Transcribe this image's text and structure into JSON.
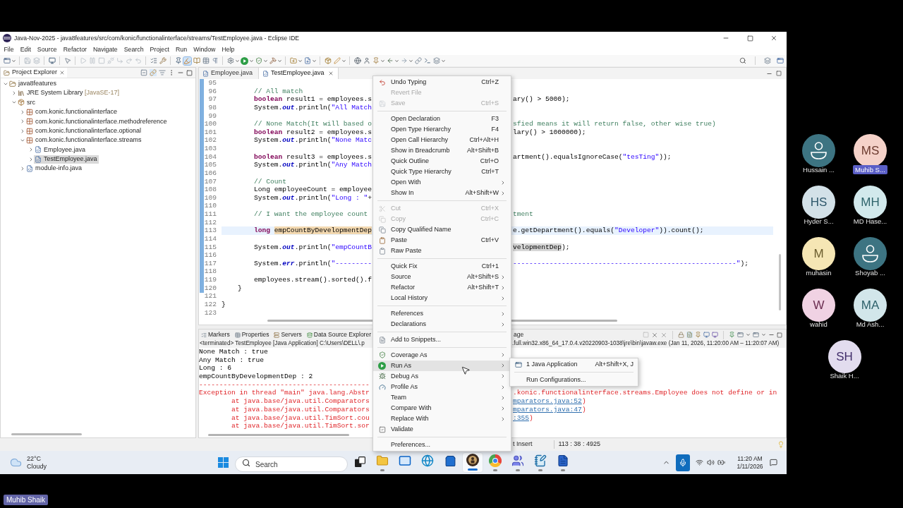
{
  "window": {
    "title": "Java-Nov-2025 - java8features/src/com/konic/functionalinterface/streams/TestEmployee.java - Eclipse IDE"
  },
  "menu_bar": [
    "File",
    "Edit",
    "Source",
    "Refactor",
    "Navigate",
    "Search",
    "Project",
    "Run",
    "Window",
    "Help"
  ],
  "toolbar": {
    "toggles": [
      {
        "on": true
      }
    ]
  },
  "project_explorer": {
    "title": "Project Explorer",
    "tree": [
      {
        "label": "java8features",
        "kind": "project",
        "expanded": true,
        "selected": false,
        "children": [
          {
            "label": "JRE System Library",
            "suffix": "[JavaSE-17]",
            "kind": "library",
            "expanded": false,
            "selected": false
          },
          {
            "label": "src",
            "kind": "source_folder",
            "expanded": true,
            "selected": false,
            "children": [
              {
                "label": "com.konic.functionalinterface",
                "kind": "package",
                "expanded": false,
                "selected": false
              },
              {
                "label": "com.konic.functionalinterface.methodreference",
                "kind": "package",
                "expanded": false,
                "selected": false
              },
              {
                "label": "com.konic.functionalinterface.optional",
                "kind": "package",
                "expanded": false,
                "selected": false
              },
              {
                "label": "com.konic.functionalinterface.streams",
                "kind": "package",
                "expanded": true,
                "selected": false,
                "children": [
                  {
                    "label": "Employee.java",
                    "kind": "java_file",
                    "expanded": false,
                    "selected": false
                  },
                  {
                    "label": "TestEmployee.java",
                    "kind": "java_file",
                    "expanded": false,
                    "selected": true
                  }
                ]
              },
              {
                "label": "module-info.java",
                "kind": "java_file",
                "expanded": false,
                "selected": false
              }
            ]
          }
        ]
      }
    ]
  },
  "editor": {
    "tabs": [
      {
        "label": "Employee.java",
        "selected": false
      },
      {
        "label": "TestEmployee.java",
        "selected": true
      }
    ],
    "lines": [
      {
        "number": "95",
        "current": false
      },
      {
        "number": "96",
        "current": false,
        "left": [
          {
            "kind": "comment",
            "text": "        // All match"
          }
        ]
      },
      {
        "number": "97",
        "current": false,
        "left": [
          {
            "kind": "keyword",
            "text": "        boolean"
          },
          {
            "kind": "plain",
            "text": " result1 = employees.s"
          }
        ],
        "right": [
          {
            "kind": "plain",
            "text": "ary() > 5000);"
          }
        ]
      },
      {
        "number": "98",
        "current": false,
        "left": [
          {
            "kind": "plain",
            "text": "        System."
          },
          {
            "kind": "field",
            "text": "out"
          },
          {
            "kind": "plain",
            "text": ".println("
          },
          {
            "kind": "string",
            "text": "\"All Match"
          }
        ]
      },
      {
        "number": "99",
        "current": false
      },
      {
        "number": "100",
        "current": false,
        "left": [
          {
            "kind": "comment",
            "text": "        // None Match(It will based o"
          }
        ],
        "right": [
          {
            "kind": "comment",
            "text": "sfied means it will return false, other wise true)"
          }
        ]
      },
      {
        "number": "101",
        "current": false,
        "left": [
          {
            "kind": "keyword",
            "text": "        boolean"
          },
          {
            "kind": "plain",
            "text": " result2 = employees.s"
          }
        ],
        "right": [
          {
            "kind": "plain",
            "text": "lary() > 1000000);"
          }
        ]
      },
      {
        "number": "102",
        "current": false,
        "left": [
          {
            "kind": "plain",
            "text": "        System."
          },
          {
            "kind": "field",
            "text": "out"
          },
          {
            "kind": "plain",
            "text": ".println("
          },
          {
            "kind": "string",
            "text": "\"None Matc"
          }
        ]
      },
      {
        "number": "103",
        "current": false
      },
      {
        "number": "104",
        "current": false,
        "left": [
          {
            "kind": "keyword",
            "text": "        boolean"
          },
          {
            "kind": "plain",
            "text": " result3 = employees.s"
          }
        ],
        "right": [
          {
            "kind": "plain",
            "text": "artment().equalsIgnoreCase("
          },
          {
            "kind": "string",
            "text": "\"tesTing\""
          },
          {
            "kind": "plain",
            "text": "));"
          }
        ]
      },
      {
        "number": "105",
        "current": false,
        "left": [
          {
            "kind": "plain",
            "text": "        System."
          },
          {
            "kind": "field",
            "text": "out"
          },
          {
            "kind": "plain",
            "text": ".println("
          },
          {
            "kind": "string",
            "text": "\"Any Match"
          }
        ]
      },
      {
        "number": "106",
        "current": false
      },
      {
        "number": "107",
        "current": false,
        "left": [
          {
            "kind": "comment",
            "text": "        // Count"
          }
        ]
      },
      {
        "number": "108",
        "current": false,
        "left": [
          {
            "kind": "plain",
            "text": "        Long employeeCount = employee"
          }
        ]
      },
      {
        "number": "109",
        "current": false,
        "left": [
          {
            "kind": "plain",
            "text": "        System."
          },
          {
            "kind": "field",
            "text": "out"
          },
          {
            "kind": "plain",
            "text": ".println("
          },
          {
            "kind": "string",
            "text": "\"Long : \""
          },
          {
            "kind": "plain",
            "text": "+"
          }
        ]
      },
      {
        "number": "110",
        "current": false
      },
      {
        "number": "111",
        "current": false,
        "left": [
          {
            "kind": "comment",
            "text": "        // I want the employee count"
          }
        ],
        "right": [
          {
            "kind": "comment",
            "text": "tment"
          }
        ]
      },
      {
        "number": "112",
        "current": false
      },
      {
        "number": "113",
        "current": true,
        "left": [
          {
            "kind": "keyword",
            "text": "        long "
          },
          {
            "kind": "mark_write",
            "text": "empCountByDevelopmentDep"
          }
        ],
        "right": [
          {
            "kind": "plain",
            "text": "e.getDepartment().equals("
          },
          {
            "kind": "string",
            "text": "\"Developer\""
          },
          {
            "kind": "plain",
            "text": ")).count();"
          }
        ]
      },
      {
        "number": "114",
        "current": false
      },
      {
        "number": "115",
        "current": false,
        "left": [
          {
            "kind": "plain",
            "text": "        System."
          },
          {
            "kind": "field",
            "text": "out"
          },
          {
            "kind": "plain",
            "text": ".println("
          },
          {
            "kind": "string",
            "text": "\"empCountB"
          }
        ],
        "right": [
          {
            "kind": "mark_read",
            "text": "velopmentDep"
          },
          {
            "kind": "plain",
            "text": ");"
          }
        ]
      },
      {
        "number": "116",
        "current": false
      },
      {
        "number": "117",
        "current": false,
        "left": [
          {
            "kind": "plain",
            "text": "        System."
          },
          {
            "kind": "field",
            "text": "err"
          },
          {
            "kind": "plain",
            "text": ".println("
          },
          {
            "kind": "string",
            "text": "\"---------"
          }
        ],
        "right": [
          {
            "kind": "string",
            "text": "-------------------------------------------------------\""
          },
          {
            "kind": "plain",
            "text": ");"
          }
        ]
      },
      {
        "number": "118",
        "current": false
      },
      {
        "number": "119",
        "current": false,
        "left": [
          {
            "kind": "plain",
            "text": "        employees.stream().sorted().f"
          }
        ]
      },
      {
        "number": "120",
        "current": false,
        "left": [
          {
            "kind": "plain",
            "text": "    }"
          }
        ]
      },
      {
        "number": "121",
        "current": false
      },
      {
        "number": "122",
        "current": false,
        "left": [
          {
            "kind": "plain",
            "text": "}"
          }
        ]
      },
      {
        "number": "123",
        "current": false
      }
    ]
  },
  "console": {
    "tabs": [
      {
        "label": "Markers",
        "selected": false
      },
      {
        "label": "Properties",
        "selected": false
      },
      {
        "label": "Servers",
        "selected": false
      },
      {
        "label": "Data Source Explorer",
        "selected": false
      },
      {
        "label": "age",
        "selected": false
      }
    ],
    "process_left": "<terminated> TestEmployee [Java Application] C:\\Users\\DELL\\.p",
    "process_right": ".full.win32.x86_64_17.0.4.v20220903-1038\\jre\\bin\\javaw.exe  (Jan 11, 2026, 11:20:00 AM – 11:20:07 AM)",
    "lines": [
      {
        "left": [
          {
            "kind": "out",
            "text": "None Match : true"
          }
        ]
      },
      {
        "left": [
          {
            "kind": "out",
            "text": "Any Match : true"
          }
        ]
      },
      {
        "left": [
          {
            "kind": "out",
            "text": "Long : 6"
          }
        ]
      },
      {
        "left": [
          {
            "kind": "out",
            "text": "empCountByDevelopmentDep : 2"
          }
        ]
      },
      {
        "left": [
          {
            "kind": "err",
            "text": "------------------------------------------"
          }
        ]
      },
      {
        "left": [
          {
            "kind": "err",
            "text": "Exception in thread \"main\" java.lang.Abstr"
          }
        ],
        "right": [
          {
            "kind": "err",
            "text": ".konic.functionalinterface.streams.Employee does not define or in"
          }
        ]
      },
      {
        "left": [
          {
            "kind": "err",
            "text": "        at java.base/java.util.Comparators"
          }
        ],
        "right": [
          {
            "kind": "link",
            "text": "mparators.java:52"
          },
          {
            "kind": "err",
            "text": ")"
          }
        ]
      },
      {
        "left": [
          {
            "kind": "err",
            "text": "        at java.base/java.util.Comparators"
          }
        ],
        "right": [
          {
            "kind": "link",
            "text": "mparators.java:47"
          },
          {
            "kind": "err",
            "text": ")"
          }
        ]
      },
      {
        "left": [
          {
            "kind": "err",
            "text": "        at java.base/java.util.TimSort.cou"
          }
        ],
        "right": [
          {
            "kind": "link",
            "text": ":355"
          },
          {
            "kind": "err",
            "text": ")"
          }
        ]
      },
      {
        "left": [
          {
            "kind": "err",
            "text": "        at java.base/java.util.TimSort.sor"
          }
        ]
      }
    ]
  },
  "status_bar": {
    "insert_mode": "t Insert",
    "cursor_position": "113 : 38 : 4925"
  },
  "context_menu": {
    "groups": [
      [
        {
          "label": "Undo Typing",
          "shortcut": "Ctrl+Z",
          "disabled": false,
          "has_submenu": false,
          "selected": false
        },
        {
          "label": "Revert File",
          "disabled": true,
          "has_submenu": false,
          "selected": false
        },
        {
          "label": "Save",
          "shortcut": "Ctrl+S",
          "disabled": true,
          "has_submenu": false,
          "selected": false
        }
      ],
      [
        {
          "label": "Open Declaration",
          "shortcut": "F3",
          "disabled": false,
          "has_submenu": false,
          "selected": false
        },
        {
          "label": "Open Type Hierarchy",
          "shortcut": "F4",
          "disabled": false,
          "has_submenu": false,
          "selected": false
        },
        {
          "label": "Open Call Hierarchy",
          "shortcut": "Ctrl+Alt+H",
          "disabled": false,
          "has_submenu": false,
          "selected": false
        },
        {
          "label": "Show in Breadcrumb",
          "shortcut": "Alt+Shift+B",
          "disabled": false,
          "has_submenu": false,
          "selected": false
        },
        {
          "label": "Quick Outline",
          "shortcut": "Ctrl+O",
          "disabled": false,
          "has_submenu": false,
          "selected": false
        },
        {
          "label": "Quick Type Hierarchy",
          "shortcut": "Ctrl+T",
          "disabled": false,
          "has_submenu": false,
          "selected": false
        },
        {
          "label": "Open With",
          "disabled": false,
          "has_submenu": true,
          "selected": false
        },
        {
          "label": "Show In",
          "shortcut": "Alt+Shift+W",
          "disabled": false,
          "has_submenu": true,
          "selected": false
        }
      ],
      [
        {
          "label": "Cut",
          "shortcut": "Ctrl+X",
          "disabled": true,
          "has_submenu": false,
          "selected": false
        },
        {
          "label": "Copy",
          "shortcut": "Ctrl+C",
          "disabled": true,
          "has_submenu": false,
          "selected": false
        },
        {
          "label": "Copy Qualified Name",
          "disabled": false,
          "has_submenu": false,
          "selected": false
        },
        {
          "label": "Paste",
          "shortcut": "Ctrl+V",
          "disabled": false,
          "has_submenu": false,
          "selected": false
        },
        {
          "label": "Raw Paste",
          "disabled": false,
          "has_submenu": false,
          "selected": false
        }
      ],
      [
        {
          "label": "Quick Fix",
          "shortcut": "Ctrl+1",
          "disabled": false,
          "has_submenu": false,
          "selected": false
        },
        {
          "label": "Source",
          "shortcut": "Alt+Shift+S",
          "disabled": false,
          "has_submenu": true,
          "selected": false
        },
        {
          "label": "Refactor",
          "shortcut": "Alt+Shift+T",
          "disabled": false,
          "has_submenu": true,
          "selected": false
        },
        {
          "label": "Local History",
          "disabled": false,
          "has_submenu": true,
          "selected": false
        }
      ],
      [
        {
          "label": "References",
          "disabled": false,
          "has_submenu": true,
          "selected": false
        },
        {
          "label": "Declarations",
          "disabled": false,
          "has_submenu": true,
          "selected": false
        }
      ],
      [
        {
          "label": "Add to Snippets...",
          "disabled": false,
          "has_submenu": false,
          "selected": false
        }
      ],
      [
        {
          "label": "Coverage As",
          "disabled": false,
          "has_submenu": true,
          "selected": false
        },
        {
          "label": "Run As",
          "disabled": false,
          "has_submenu": true,
          "selected": true,
          "submenu_groups": [
            [
              {
                "label": "1 Java Application",
                "shortcut": "Alt+Shift+X, J",
                "selected": false
              }
            ],
            [
              {
                "label": "Run Configurations...",
                "selected": false
              }
            ]
          ]
        },
        {
          "label": "Debug As",
          "disabled": false,
          "has_submenu": true,
          "selected": false
        },
        {
          "label": "Profile As",
          "disabled": false,
          "has_submenu": true,
          "selected": false
        },
        {
          "label": "Team",
          "disabled": false,
          "has_submenu": true,
          "selected": false
        },
        {
          "label": "Compare With",
          "disabled": false,
          "has_submenu": true,
          "selected": false
        },
        {
          "label": "Replace With",
          "disabled": false,
          "has_submenu": true,
          "selected": false
        },
        {
          "label": "Validate",
          "disabled": false,
          "has_submenu": false,
          "selected": false
        }
      ],
      [
        {
          "label": "Preferences...",
          "disabled": false,
          "has_submenu": false,
          "selected": false
        }
      ]
    ]
  },
  "taskbar": {
    "weather": {
      "temperature": "22°C",
      "condition": "Cloudy"
    },
    "search": {
      "placeholder": "Search"
    },
    "apps": [
      {
        "running": false,
        "selected": false
      },
      {
        "running": true,
        "selected": false
      },
      {
        "running": false,
        "selected": false
      },
      {
        "running": false,
        "selected": false
      },
      {
        "running": false,
        "selected": false
      },
      {
        "running": true,
        "selected": true
      },
      {
        "running": true,
        "selected": false
      },
      {
        "running": true,
        "selected": false
      },
      {
        "running": true,
        "selected": false
      },
      {
        "running": true,
        "selected": false
      }
    ],
    "clock": {
      "time": "11:20 AM",
      "date": "1/11/2026"
    }
  },
  "participants": [
    {
      "name": "Hussain ...",
      "kind": "silhouette",
      "color": "#3d7482",
      "selected": false
    },
    {
      "name": "Muhib S...",
      "kind": "initials",
      "initials": "MS",
      "color": "#f5d2c9",
      "selected": true
    },
    {
      "name": "Hyder S...",
      "kind": "initials",
      "initials": "HS",
      "color": "#d3e1e8",
      "selected": false
    },
    {
      "name": "MD Hase...",
      "kind": "initials",
      "initials": "MH",
      "color": "#d2e9ec",
      "selected": false
    },
    {
      "name": "muhasin",
      "kind": "initials",
      "initials": "M",
      "color": "#f5e6b4",
      "selected": false
    },
    {
      "name": "Shoyab ...",
      "kind": "silhouette",
      "color": "#3d7482",
      "selected": false
    },
    {
      "name": "wahid",
      "kind": "initials",
      "initials": "W",
      "color": "#f0d2e3",
      "selected": false
    },
    {
      "name": "Md Ash...",
      "kind": "initials",
      "initials": "MA",
      "color": "#d2e6ea",
      "selected": false
    },
    {
      "name": "Shaik H...",
      "kind": "initials",
      "initials": "SH",
      "color": "#e2dcee",
      "selected": false
    }
  ],
  "presenter_label": "Muhib Shaik"
}
